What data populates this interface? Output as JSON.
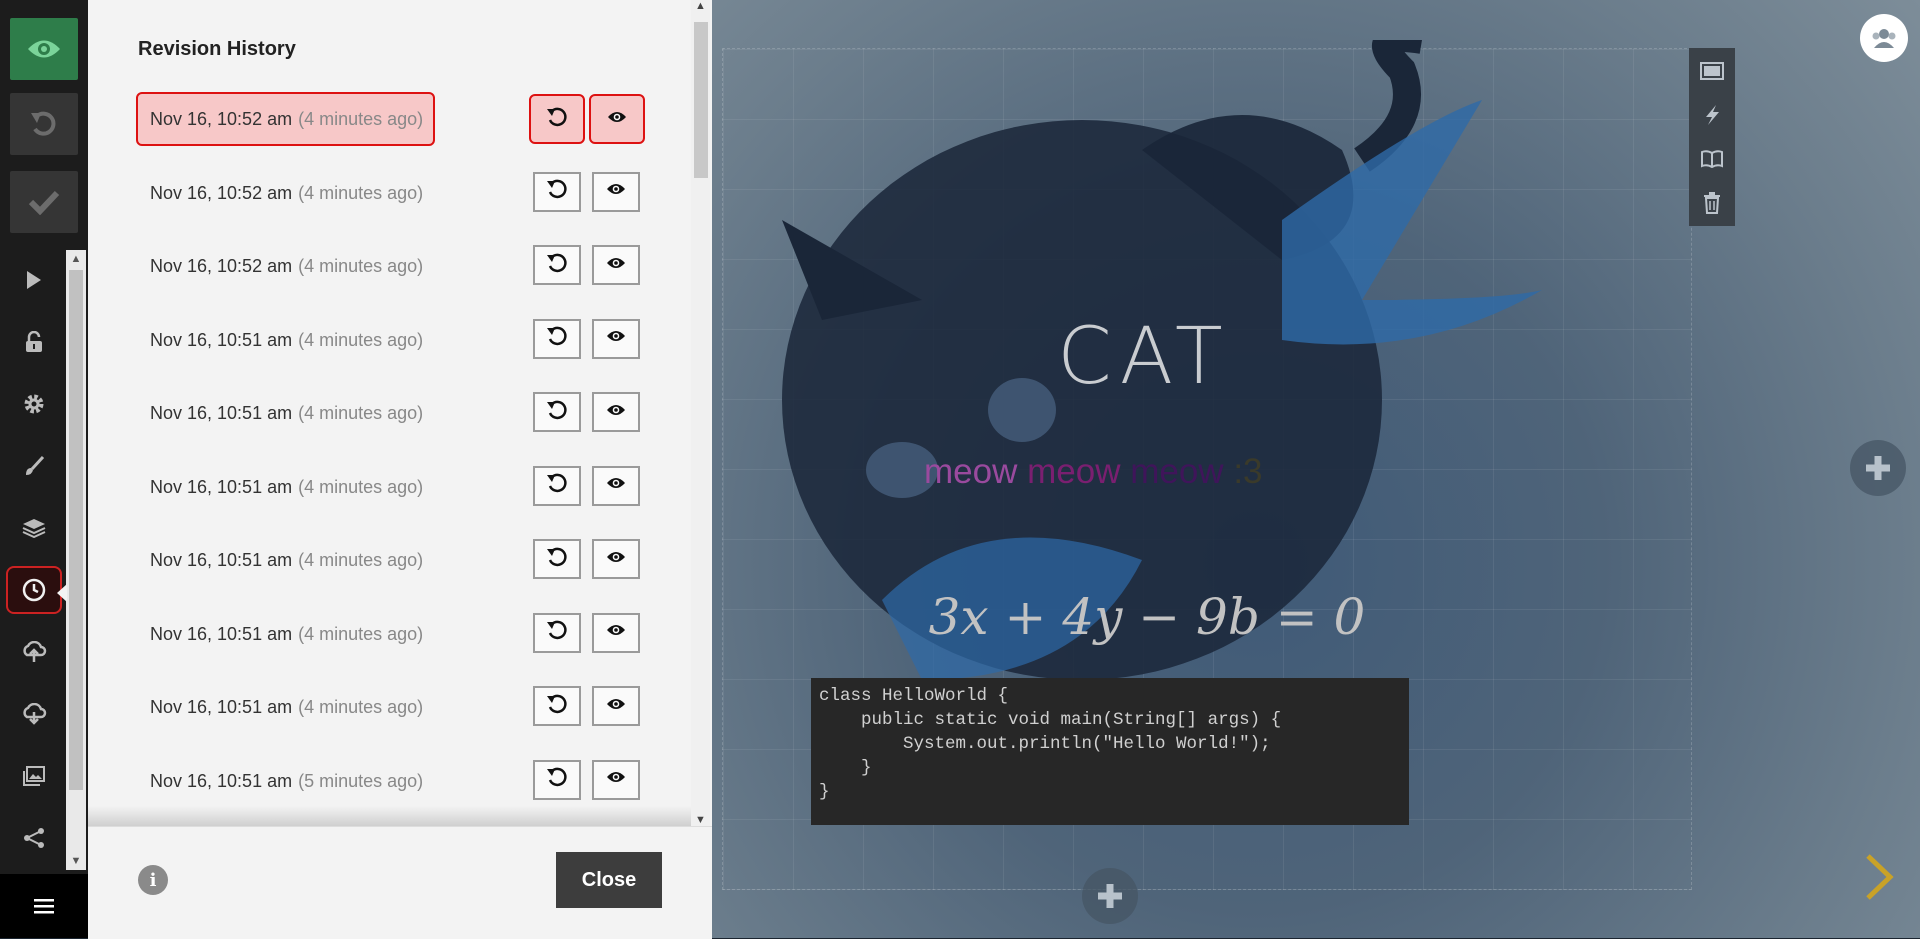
{
  "toolbar": {
    "top_buttons": [
      {
        "name": "preview",
        "icon": "eye-icon"
      },
      {
        "name": "undo",
        "icon": "undo-icon"
      },
      {
        "name": "done",
        "icon": "check-icon"
      }
    ],
    "tools": [
      {
        "name": "present",
        "icon": "play-icon"
      },
      {
        "name": "lock",
        "icon": "lock-icon"
      },
      {
        "name": "settings",
        "icon": "gear-icon"
      },
      {
        "name": "style",
        "icon": "brush-icon"
      },
      {
        "name": "layers",
        "icon": "layers-icon"
      },
      {
        "name": "revision-history",
        "icon": "clock-icon",
        "active": true
      },
      {
        "name": "import",
        "icon": "cloud-upload-icon"
      },
      {
        "name": "export",
        "icon": "cloud-download-icon"
      },
      {
        "name": "media",
        "icon": "image-icon"
      },
      {
        "name": "share",
        "icon": "share-icon"
      }
    ],
    "menu_icon": "hamburger-icon"
  },
  "revision_panel": {
    "title": "Revision History",
    "revisions": [
      {
        "time": "Nov 16, 10:52 am",
        "ago": "(4 minutes ago)",
        "selected": true
      },
      {
        "time": "Nov 16, 10:52 am",
        "ago": "(4 minutes ago)"
      },
      {
        "time": "Nov 16, 10:52 am",
        "ago": "(4 minutes ago)"
      },
      {
        "time": "Nov 16, 10:51 am",
        "ago": "(4 minutes ago)"
      },
      {
        "time": "Nov 16, 10:51 am",
        "ago": "(4 minutes ago)"
      },
      {
        "time": "Nov 16, 10:51 am",
        "ago": "(4 minutes ago)"
      },
      {
        "time": "Nov 16, 10:51 am",
        "ago": "(4 minutes ago)"
      },
      {
        "time": "Nov 16, 10:51 am",
        "ago": "(4 minutes ago)"
      },
      {
        "time": "Nov 16, 10:51 am",
        "ago": "(4 minutes ago)"
      },
      {
        "time": "Nov 16, 10:51 am",
        "ago": "(5 minutes ago)"
      }
    ],
    "restore_icon": "restore-icon",
    "view_icon": "eye-icon",
    "info_label": "i",
    "close_label": "Close"
  },
  "slide": {
    "title": "CAT",
    "subtitle_words": [
      "meow",
      "meow",
      "meow",
      ":3"
    ],
    "equation": "3x + 4y − 9b = 0",
    "code_lines": [
      "class HelloWorld {",
      "    public static void main(String[] args) {",
      "        System.out.println(\"Hello World!\");",
      "    }",
      "}"
    ],
    "block_tools": [
      "frame-icon",
      "lightning-icon",
      "book-icon",
      "trash-icon"
    ],
    "collaborators_icon": "users-icon",
    "add_icon": "plus-icon",
    "next_icon": "chevron-right-icon"
  },
  "colors": {
    "accent_red": "#dd1111",
    "selected_bg": "#f7c8c8",
    "preview_green": "#2e7d4a",
    "next_arrow": "#c9a227"
  }
}
